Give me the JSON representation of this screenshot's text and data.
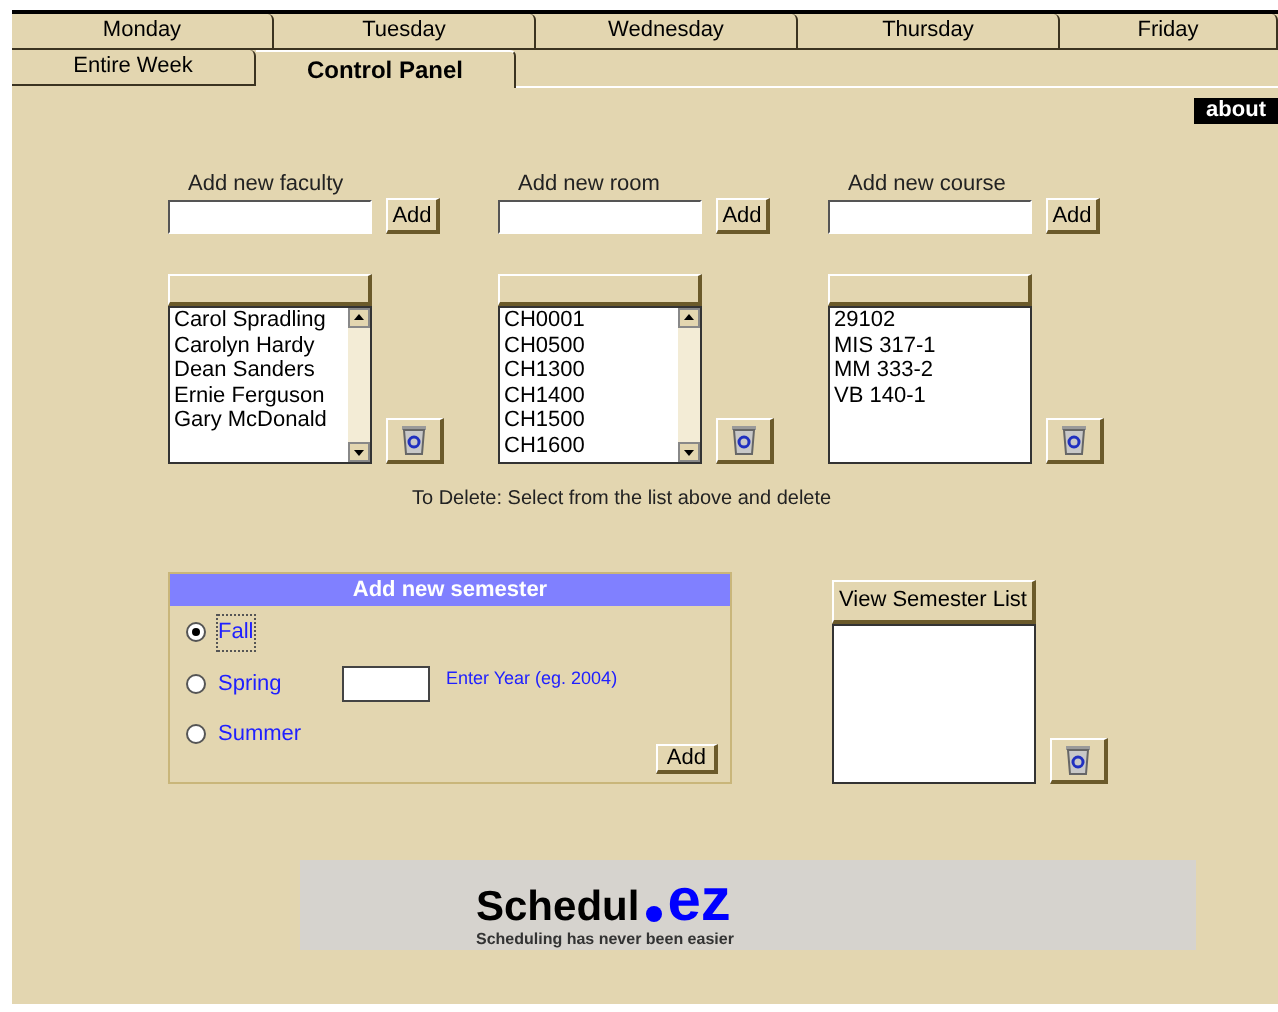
{
  "tabs_row_1": [
    {
      "label": "Monday",
      "selected": false
    },
    {
      "label": "Tuesday",
      "selected": false
    },
    {
      "label": "Wednesday",
      "selected": false
    },
    {
      "label": "Thursday",
      "selected": false
    },
    {
      "label": "Friday",
      "selected": false
    }
  ],
  "tabs_row_2": [
    {
      "label": "Entire Week",
      "selected": false
    },
    {
      "label": "Control Panel",
      "selected": true
    }
  ],
  "about_button": "about",
  "adders": [
    {
      "label": "Add new faculty",
      "button": "Add",
      "items": [
        "Carol Spradling",
        "Carolyn Hardy",
        "Dean Sanders",
        "Ernie Ferguson",
        "Gary McDonald"
      ],
      "scrollbar": true
    },
    {
      "label": "Add new room",
      "button": "Add",
      "items": [
        "CH0001",
        "CH0500",
        "CH1300",
        "CH1400",
        "CH1500",
        "CH1600"
      ],
      "scrollbar": true
    },
    {
      "label": "Add new course",
      "button": "Add",
      "items": [
        "29102",
        "MIS 317-1",
        "MM 333-2",
        "VB 140-1"
      ],
      "scrollbar": false
    }
  ],
  "delete_hint": "To Delete: Select from the list above and delete",
  "semester": {
    "title": "Add new semester",
    "options": [
      {
        "label": "Fall",
        "selected": true
      },
      {
        "label": "Spring",
        "selected": false
      },
      {
        "label": "Summer",
        "selected": false
      }
    ],
    "year_hint": "Enter Year (eg. 2004)",
    "button": "Add"
  },
  "semester_list": {
    "button": "View Semester List"
  },
  "logo": {
    "name": "Schedul",
    "suffix": "ez",
    "tagline": "Scheduling has never been easier"
  }
}
